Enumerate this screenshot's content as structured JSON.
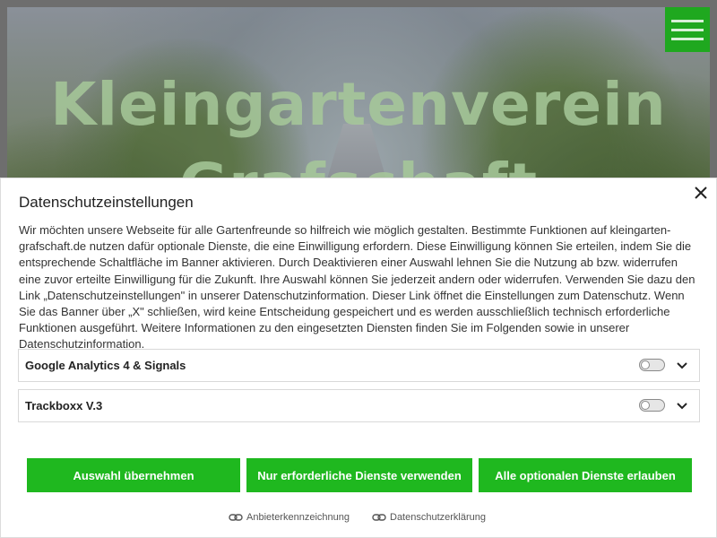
{
  "hero": {
    "title_line1": "Kleingartenverein",
    "title_line2": "Grafschaft"
  },
  "menu": {
    "icon": "hamburger-icon"
  },
  "consent": {
    "title": "Datenschutzeinstellungen",
    "body": "Wir möchten unsere Webseite für alle Gartenfreunde so hilfreich wie möglich gestalten. Bestimmte Funktionen auf kleingarten-grafschaft.de nutzen dafür optionale Dienste, die eine Einwilligung erfordern. Diese Einwilligung können Sie erteilen, indem Sie die entsprechende Schaltfläche im Banner aktivieren. Durch Deaktivieren einer Auswahl lehnen Sie die Nutzung ab bzw. widerrufen eine zuvor erteilte Einwilligung für die Zukunft. Ihre Auswahl können Sie jederzeit andern oder widerrufen. Verwenden Sie dazu den Link „Datenschutzeinstellungen\" in unserer Datenschutzinformation. Dieser Link öffnet die Einstellungen zum Datenschutz. Wenn Sie das Banner über „X\" schließen, wird keine Entscheidung gespeichert und es werden ausschließlich technisch erforderliche Funktionen ausgeführt. Weitere Informationen zu den eingesetzten Diensten finden Sie im Folgenden sowie in unserer Datenschutzinformation.",
    "services": [
      {
        "name": "Google Analytics 4 & Signals",
        "enabled": false
      },
      {
        "name": "Trackboxx V.3",
        "enabled": false
      }
    ],
    "buttons": {
      "accept_selection": "Auswahl übernehmen",
      "only_required": "Nur erforderliche Dienste verwenden",
      "allow_all": "Alle optionalen Dienste erlauben"
    },
    "links": {
      "imprint": "Anbieterkennzeichnung",
      "privacy": "Datenschutzerklärung"
    }
  },
  "colors": {
    "accent_green": "#1fb81f",
    "hero_title": "#a7c99a"
  }
}
